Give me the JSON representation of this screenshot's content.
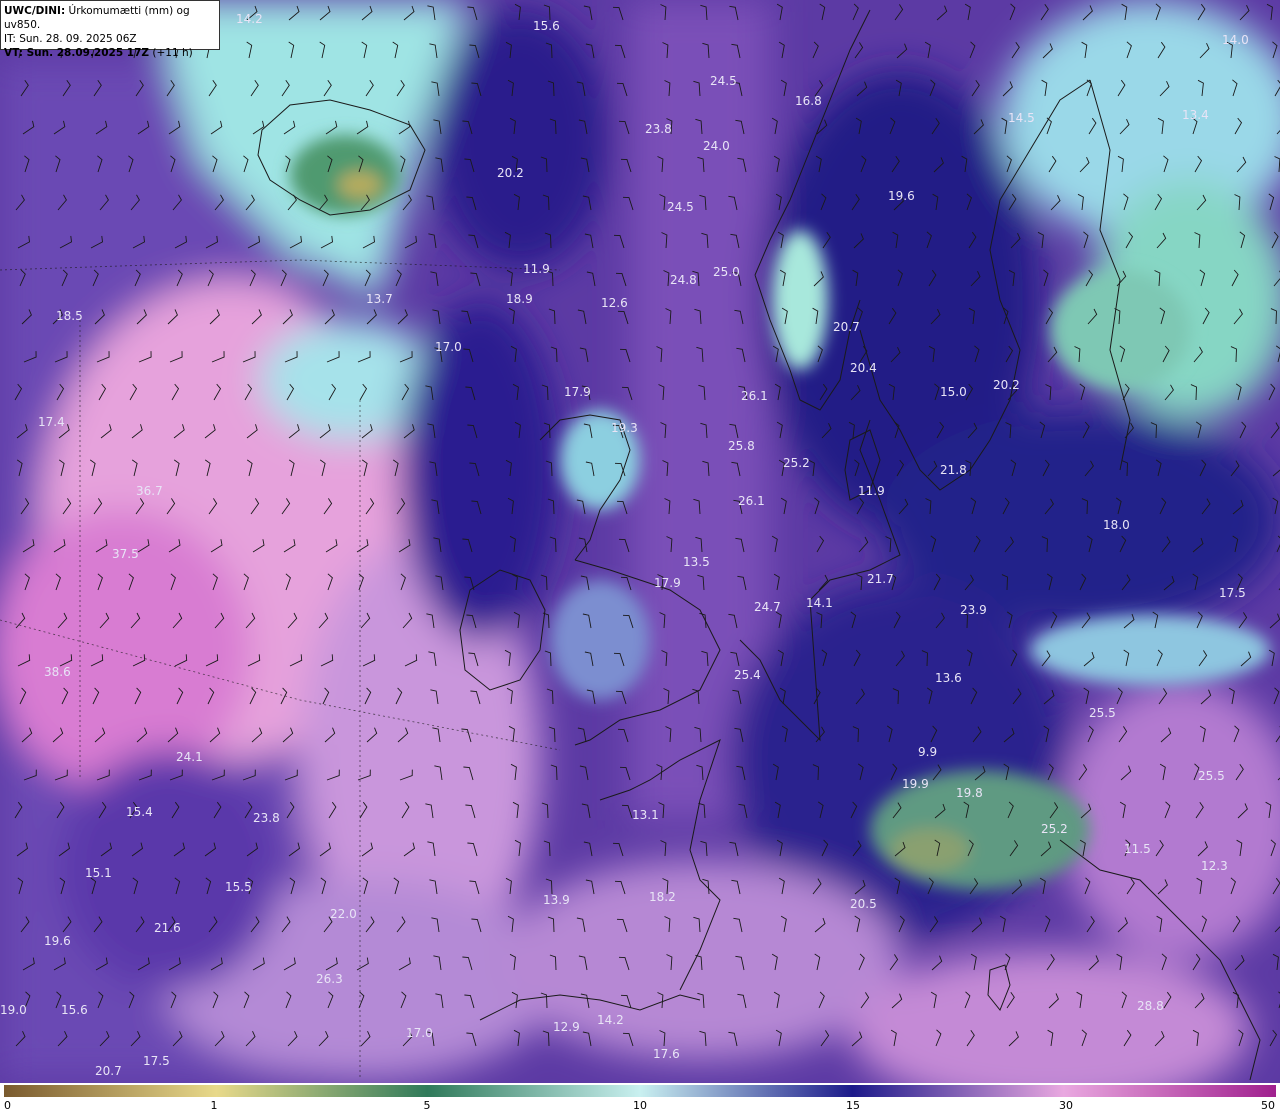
{
  "header": {
    "model": "UWC/DINI:",
    "product": " Úrkomumætti (mm) og uv850.",
    "init_time": "IT: Sun. 28. 09. 2025 06Z",
    "valid_time_label": "VT: Sun. 28.09.2025 17Z",
    "valid_time_offset": " (+11 h)"
  },
  "colorbar": {
    "labels": [
      "0",
      "1",
      "5",
      "10",
      "15",
      "30",
      "50"
    ],
    "stops": [
      {
        "value": 0,
        "color": "#7a5a2e"
      },
      {
        "value": 1,
        "color": "#e8d98a"
      },
      {
        "value": 5,
        "color": "#2f7a5a"
      },
      {
        "value": 10,
        "color": "#c9f0f0"
      },
      {
        "value": 15,
        "color": "#1c1a8a"
      },
      {
        "value": 30,
        "color": "#e9a8e0"
      },
      {
        "value": 50,
        "color": "#a0208e"
      }
    ]
  },
  "values": [
    "14.2",
    "15.6",
    "14.0",
    "24.5",
    "16.8",
    "14.5",
    "13.4",
    "23.8",
    "24.0",
    "20.2",
    "19.6",
    "24.5",
    "11.9",
    "25.0",
    "24.8",
    "18.9",
    "12.6",
    "13.7",
    "18.5",
    "20.7",
    "20.4",
    "17.0",
    "17.9",
    "26.1",
    "15.0",
    "20.2",
    "17.4",
    "19.3",
    "25.8",
    "25.2",
    "21.8",
    "36.7",
    "11.9",
    "26.1",
    "18.0",
    "37.5",
    "13.5",
    "17.9",
    "21.7",
    "24.7",
    "14.1",
    "23.9",
    "17.5",
    "38.6",
    "25.4",
    "13.6",
    "25.5",
    "24.1",
    "9.9",
    "19.9",
    "25.5",
    "15.4",
    "23.8",
    "13.1",
    "19.8",
    "25.2",
    "11.5",
    "15.1",
    "15.5",
    "12.3",
    "13.9",
    "18.2",
    "20.5",
    "22.0",
    "21.6",
    "19.6",
    "26.3",
    "19.0",
    "15.6",
    "12.9",
    "14.2",
    "17.0",
    "17.6",
    "28.8",
    "17.5",
    "20.7"
  ],
  "colors": {
    "land_outline": "#1a1a1a",
    "wind_barb": "#1a1a1a",
    "value_text": "#e8e4f6"
  }
}
